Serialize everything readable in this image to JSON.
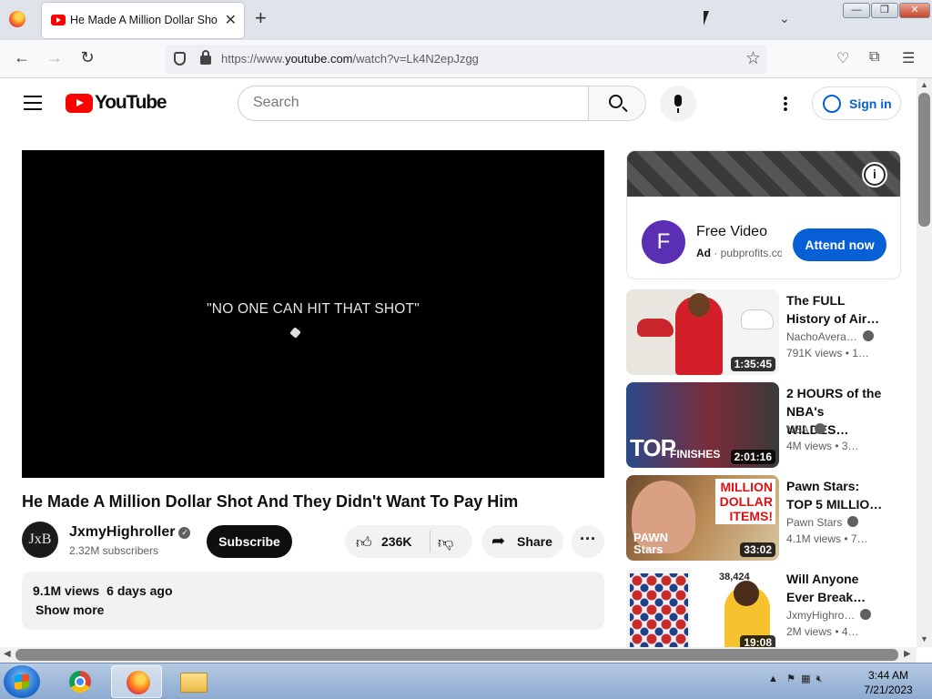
{
  "browser": {
    "tab_title": "He Made A Million Dollar Shot And They Didn't Want To Pay Him",
    "tab_close": "✕",
    "new_tab": "+",
    "url_prefix": "https://www.",
    "url_domain": "youtube.com",
    "url_path": "/watch?v=Lk4N2epJzgg",
    "window_buttons": [
      "—",
      "❐",
      "✕"
    ]
  },
  "youtube": {
    "logo_text": "YouTube",
    "search_placeholder": "Search",
    "signin_label": "Sign in"
  },
  "video": {
    "overlay_caption": "\"NO ONE CAN HIT THAT SHOT\"",
    "title": "He Made A Million Dollar Shot And They Didn't Want To Pay Him",
    "channel_name": "JxmyHighroller",
    "channel_avatar_text": "JxB",
    "subscribers": "2.32M subscribers",
    "subscribe_label": "Subscribe",
    "likes": "236K",
    "share_label": "Share",
    "views": "9.1M views",
    "posted": "6 days ago",
    "show_more": "Show more"
  },
  "ad": {
    "logo_letter": "F",
    "headline": "Free Video",
    "badge": "Ad",
    "sponsor": "pubprofits.com",
    "cta": "Attend now"
  },
  "recommendations": [
    {
      "title": "The FULL History of Air…",
      "channel": "NachoAvera…",
      "stats": "791K views • 1…",
      "duration": "1:35:45"
    },
    {
      "title": "2 HOURS of the NBA's WILDES…",
      "channel": "NBA",
      "stats": "4M views • 3…",
      "duration": "2:01:16",
      "thumb_text": "TOP",
      "thumb_sub": "FINISHES"
    },
    {
      "title": "Pawn Stars: TOP 5 MILLIO…",
      "channel": "Pawn Stars",
      "stats": "4.1M views • 7…",
      "duration": "33:02",
      "thumb_tag": "MILLION DOLLAR ITEMS!",
      "thumb_brand": "PAWN Stars"
    },
    {
      "title": "Will Anyone Ever Break…",
      "channel": "JxmyHighro…",
      "stats": "2M views • 4…",
      "duration": "19:08",
      "thumb_num": "38,424"
    }
  ],
  "taskbar": {
    "time": "3:44 AM",
    "date": "7/21/2023"
  }
}
